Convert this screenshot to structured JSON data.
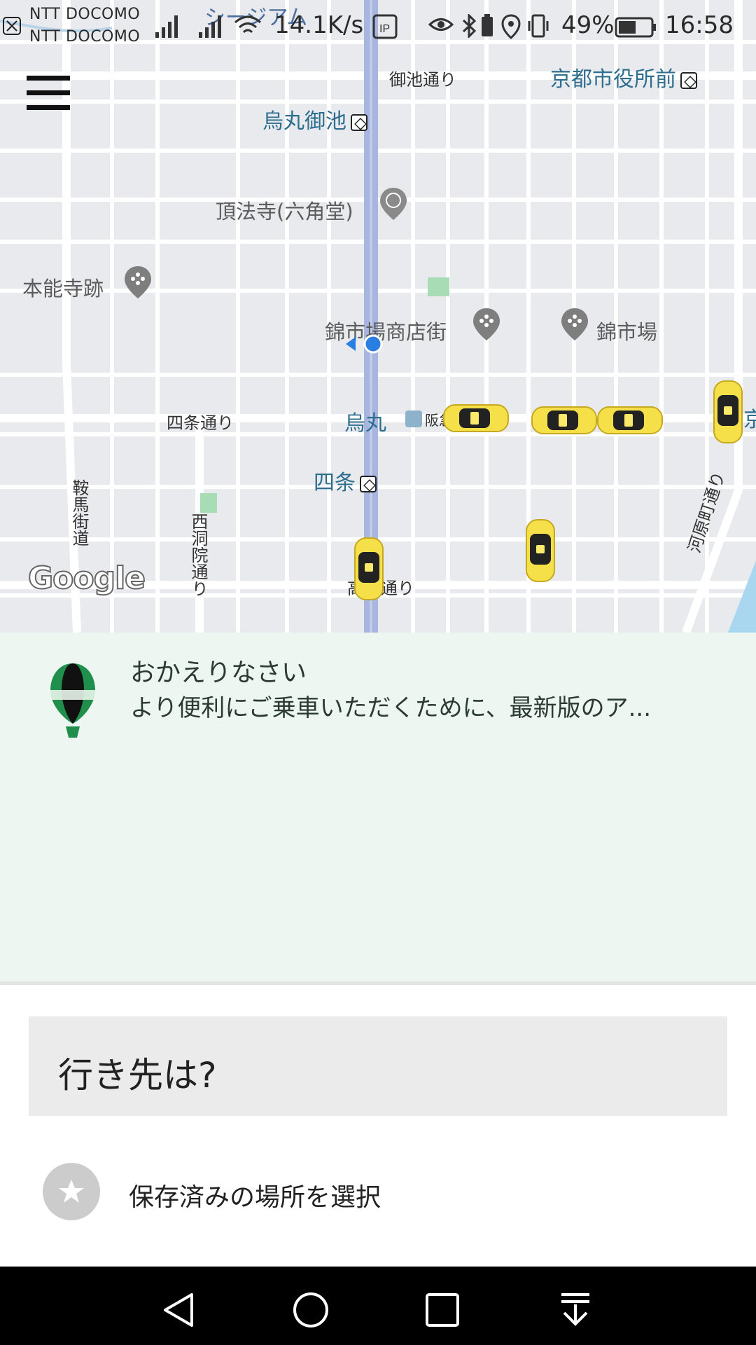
{
  "status_bar": {
    "carrier_1": "NTT DOCOMO",
    "carrier_2": "NTT DOCOMO",
    "speed": "14.1K/s",
    "battery": "49%",
    "time": "16:58"
  },
  "map": {
    "labels": {
      "oike_dori": "御池通り",
      "shiyakusho": "京都市役所前",
      "karasuma_oike": "烏丸御池",
      "chohoji": "頂法寺(六角堂)",
      "honnoji": "本能寺跡",
      "nishiki_shotengai": "錦市場商店街",
      "nishiki_ichiba": "錦市場",
      "shijo_dori": "四条通り",
      "karasuma": "烏丸",
      "hankyu": "阪急",
      "shijo": "四条",
      "kurama_kaido": "鞍馬街道",
      "nishinotoin": "西洞院通り",
      "takatsuji": "高辻通り",
      "kawaramachi": "河原町通り",
      "partial_top": "シージアム",
      "partial_right": "京"
    },
    "logo": "Google",
    "icons": [
      "hamburger-menu-icon",
      "metro-station-icon",
      "place-pin-icon",
      "taxi-icon",
      "current-location-icon"
    ]
  },
  "welcome": {
    "title": "おかえりなさい",
    "body": "より便利にご乗車いただくために、最新版のア..."
  },
  "destination": {
    "placeholder": "行き先は?"
  },
  "saved_places": {
    "label": "保存済みの場所を選択"
  },
  "colors": {
    "map_bg": "#e9eaee",
    "main_road": "#a8b6df",
    "panel_bg": "#eef6f1",
    "taxi_yellow": "#f6e04a",
    "accent_green": "#2ba35a"
  }
}
